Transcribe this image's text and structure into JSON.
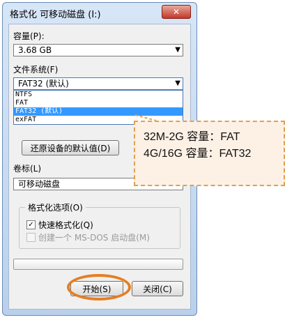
{
  "dialog": {
    "title": "格式化 可移动磁盘 (I:)",
    "close_icon": "close-icon",
    "capacity_label": "容量(P):",
    "capacity_value": "3.68 GB",
    "filesystem_label": "文件系统(F)",
    "filesystem_value": "FAT32 (默认)",
    "filesystem_options": [
      "NTFS",
      "FAT",
      "FAT32 (默认)",
      "exFAT"
    ],
    "filesystem_selected_index": 2,
    "restore_defaults_button": "还原设备的默认值(D)",
    "volume_label_label": "卷标(L)",
    "volume_label_value": "可移动磁盘",
    "format_options_label": "格式化选项(O)",
    "quick_format_label": "快速格式化(Q)",
    "quick_format_checked": true,
    "msdos_boot_label": "创建一个 MS-DOS 启动盘(M)",
    "msdos_boot_checked": false,
    "start_button": "开始(S)",
    "close_button": "关闭(C)"
  },
  "annotation": {
    "line1": "32M-2G 容量：FAT",
    "line2": "4G/16G 容量：FAT32",
    "border_color": "#e0a050",
    "fill_color": "#fdf1e6"
  },
  "highlight": {
    "ring_color": "#e67e22"
  }
}
